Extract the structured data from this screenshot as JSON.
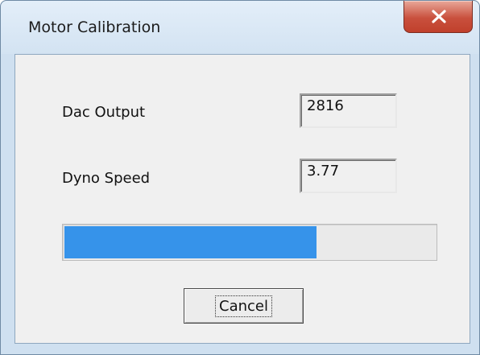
{
  "window": {
    "title": "Motor Calibration"
  },
  "fields": {
    "dac_output": {
      "label": "Dac Output",
      "value": "2816"
    },
    "dyno_speed": {
      "label": "Dyno Speed",
      "value": "3.77"
    }
  },
  "progress": {
    "fraction": 0.68,
    "fill_color": "#3693ea"
  },
  "buttons": {
    "cancel_label": "Cancel"
  },
  "icons": {
    "close": "close-icon"
  },
  "colors": {
    "titlebar": "#d8e6f4",
    "close_button": "#c9503d",
    "dialog_face": "#f0f0f0"
  }
}
